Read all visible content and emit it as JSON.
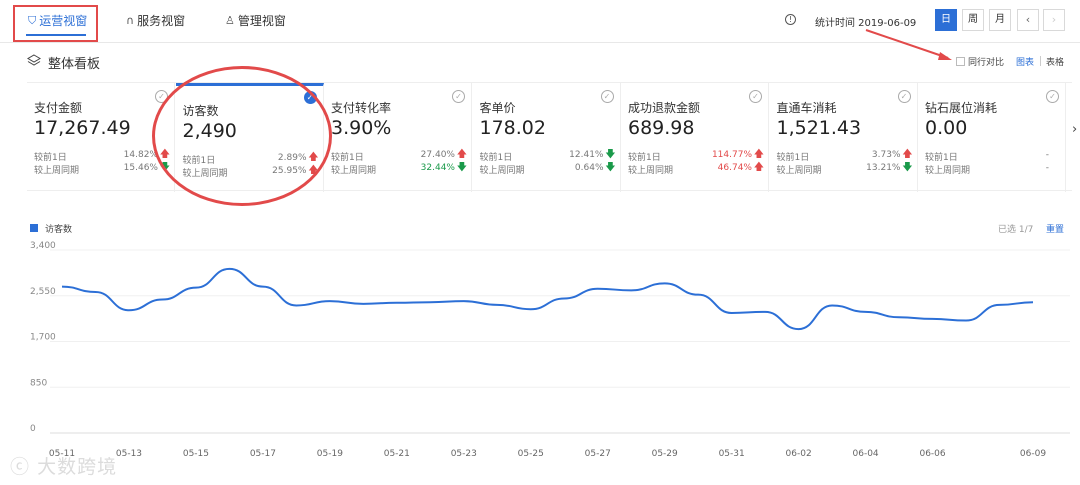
{
  "tabs": [
    {
      "label": "运营视窗",
      "icon": "shield-icon",
      "active": true
    },
    {
      "label": "服务视窗",
      "icon": "headset-icon",
      "active": false
    },
    {
      "label": "管理视窗",
      "icon": "user-icon",
      "active": false
    }
  ],
  "stat_time_label": "统计时间 2019-06-09",
  "period_buttons": [
    "日",
    "周",
    "月"
  ],
  "active_period": "日",
  "section_title": "整体看板",
  "peer_compare_label": "同行对比",
  "view_chart_label": "图表",
  "view_table_label": "表格",
  "cards": [
    {
      "title": "支付金额",
      "value": "17,267.49",
      "day_label": "较前1日",
      "day_value": "14.82%",
      "day_dir": "up",
      "week_label": "较上周同期",
      "week_value": "15.46%",
      "week_dir": "down",
      "selected": false
    },
    {
      "title": "访客数",
      "value": "2,490",
      "day_label": "较前1日",
      "day_value": "2.89%",
      "day_dir": "up",
      "week_label": "较上周同期",
      "week_value": "25.95%",
      "week_dir": "up",
      "selected": true
    },
    {
      "title": "支付转化率",
      "value": "3.90%",
      "day_label": "较前1日",
      "day_value": "27.40%",
      "day_dir": "up",
      "week_label": "较上周同期",
      "week_value": "32.44%",
      "week_dir": "down",
      "week_color": "green",
      "selected": false
    },
    {
      "title": "客单价",
      "value": "178.02",
      "day_label": "较前1日",
      "day_value": "12.41%",
      "day_dir": "down",
      "week_label": "较上周同期",
      "week_value": "0.64%",
      "week_dir": "down",
      "selected": false
    },
    {
      "title": "成功退款金额",
      "value": "689.98",
      "day_label": "较前1日",
      "day_value": "114.77%",
      "day_dir": "up",
      "day_color": "red",
      "week_label": "较上周同期",
      "week_value": "46.74%",
      "week_dir": "up",
      "week_color": "red",
      "selected": false
    },
    {
      "title": "直通车消耗",
      "value": "1,521.43",
      "day_label": "较前1日",
      "day_value": "3.73%",
      "day_dir": "up",
      "week_label": "较上周同期",
      "week_value": "13.21%",
      "week_dir": "down",
      "selected": false
    },
    {
      "title": "钻石展位消耗",
      "value": "0.00",
      "day_label": "较前1日",
      "day_value": "-",
      "day_dir": "none",
      "week_label": "较上周同期",
      "week_value": "-",
      "week_dir": "none",
      "selected": false
    }
  ],
  "chart": {
    "legend_label": "访客数",
    "selected_count": "已选 1/7",
    "reset_label": "重置",
    "color": "#2c6fd6"
  },
  "chart_data": {
    "type": "line",
    "ylim": [
      0,
      3400
    ],
    "yticks": [
      "3,400",
      "2,550",
      "1,700",
      "850",
      "0"
    ],
    "xtick_labels": [
      "05-11",
      "05-13",
      "05-15",
      "05-17",
      "05-19",
      "05-21",
      "05-23",
      "05-25",
      "05-27",
      "05-29",
      "05-31",
      "06-02",
      "06-04",
      "06-06",
      "06-09"
    ],
    "x": [
      "05-11",
      "05-12",
      "05-13",
      "05-14",
      "05-15",
      "05-16",
      "05-17",
      "05-18",
      "05-19",
      "05-20",
      "05-21",
      "05-22",
      "05-23",
      "05-24",
      "05-25",
      "05-26",
      "05-27",
      "05-28",
      "05-29",
      "05-30",
      "05-31",
      "06-01",
      "06-02",
      "06-03",
      "06-04",
      "06-05",
      "06-06",
      "06-07",
      "06-08",
      "06-09"
    ],
    "series": [
      {
        "name": "访客数",
        "values": [
          2720,
          2620,
          2280,
          2480,
          2700,
          3050,
          2720,
          2370,
          2450,
          2400,
          2420,
          2430,
          2450,
          2380,
          2300,
          2500,
          2680,
          2650,
          2780,
          2570,
          2230,
          2250,
          1930,
          2370,
          2250,
          2150,
          2120,
          2090,
          2380,
          2430
        ]
      }
    ]
  },
  "watermark": "大数跨境"
}
